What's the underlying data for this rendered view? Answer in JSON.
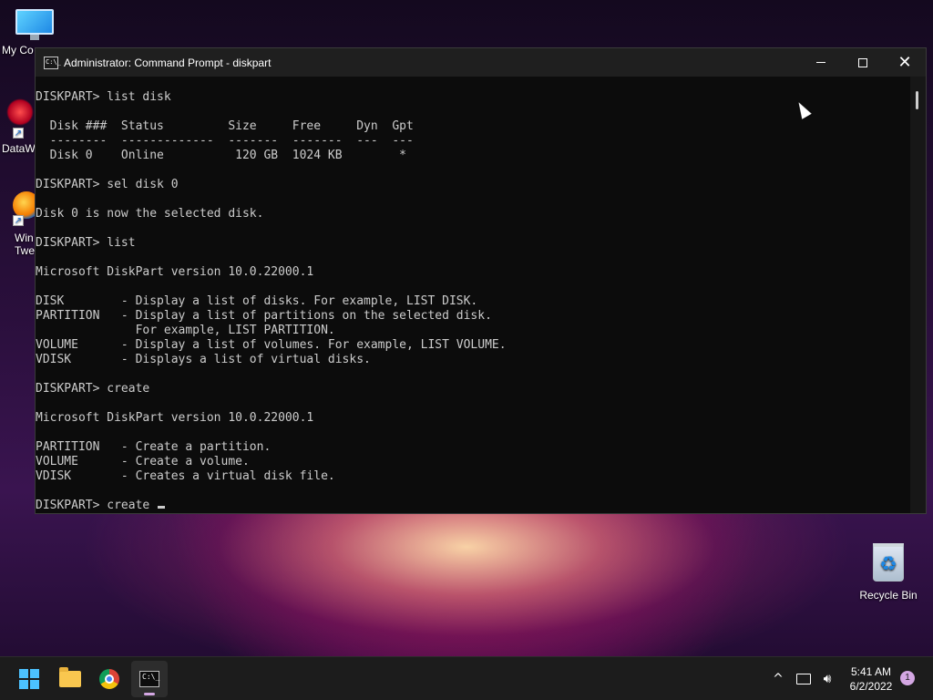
{
  "desktop": {
    "icons": [
      {
        "label": "My Co"
      },
      {
        "label": "DataW"
      },
      {
        "label": "Win",
        "label2": "Twe"
      }
    ],
    "recycle_bin": {
      "label": "Recycle Bin"
    }
  },
  "window": {
    "title": "Administrator: Command Prompt - diskpart",
    "app_icon_text": "C:\\_",
    "buttons": {
      "minimize": "minimize",
      "maximize": "maximize",
      "close": "✕"
    }
  },
  "console": {
    "lines": [
      "DISKPART> list disk",
      "",
      "  Disk ###  Status         Size     Free     Dyn  Gpt",
      "  --------  -------------  -------  -------  ---  ---",
      "  Disk 0    Online          120 GB  1024 KB        *",
      "",
      "DISKPART> sel disk 0",
      "",
      "Disk 0 is now the selected disk.",
      "",
      "DISKPART> list",
      "",
      "Microsoft DiskPart version 10.0.22000.1",
      "",
      "DISK        - Display a list of disks. For example, LIST DISK.",
      "PARTITION   - Display a list of partitions on the selected disk.",
      "              For example, LIST PARTITION.",
      "VOLUME      - Display a list of volumes. For example, LIST VOLUME.",
      "VDISK       - Displays a list of virtual disks.",
      "",
      "DISKPART> create",
      "",
      "Microsoft DiskPart version 10.0.22000.1",
      "",
      "PARTITION   - Create a partition.",
      "VOLUME      - Create a volume.",
      "VDISK       - Creates a virtual disk file.",
      "",
      "DISKPART> create "
    ]
  },
  "taskbar": {
    "apps": [
      "start-icon",
      "file-explorer-icon",
      "chrome-icon",
      "command-prompt-icon"
    ],
    "active_app": "command-prompt-icon",
    "tray": {
      "chevron": "^",
      "network": "network-icon",
      "volume": "volume-icon"
    },
    "clock": {
      "time": "5:41 AM",
      "date": "6/2/2022"
    },
    "notification_count": "1"
  }
}
